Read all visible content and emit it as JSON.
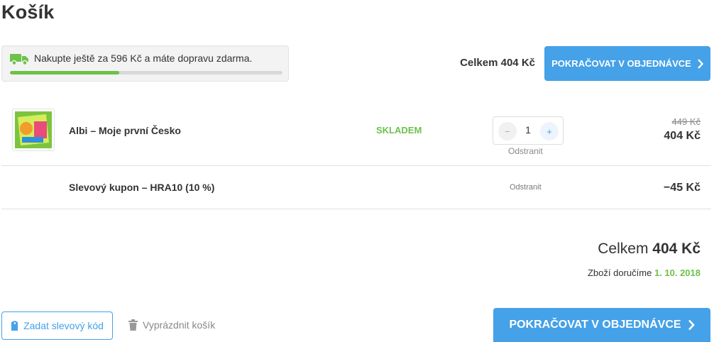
{
  "page": {
    "title": "Košík"
  },
  "shipping": {
    "message": "Nakupte ještě za 596 Kč a máte dopravu zdarma.",
    "progress_fraction": 0.4
  },
  "header_total": "Celkem 404 Kč",
  "continue_label": "POKRAČOVAT V OBJEDNÁVCE",
  "cart_item": {
    "name": "Albi – Moje první Česko",
    "stock": "SKLADEM",
    "quantity": "1",
    "minus": "−",
    "plus": "+",
    "remove_label": "Odstranit",
    "old_price": "449 Kč",
    "price": "404 Kč",
    "image_lettering": "Moje první Česko"
  },
  "coupon": {
    "name": "Slevový kupon – HRA10 (10 %)",
    "remove_label": "Odstranit",
    "value": "−45 Kč"
  },
  "summary": {
    "total_label": "Celkem",
    "total_value": "404 Kč",
    "delivery_label": "Zboží doručíme",
    "delivery_date": "1. 10. 2018"
  },
  "actions": {
    "coupon_button": "Zadat slevový kód",
    "empty_cart": "Vyprázdnit košík"
  },
  "colors": {
    "accent_blue": "#45a1e8",
    "stock_green": "#6cc24a",
    "progress_green": "#6cc24a"
  }
}
